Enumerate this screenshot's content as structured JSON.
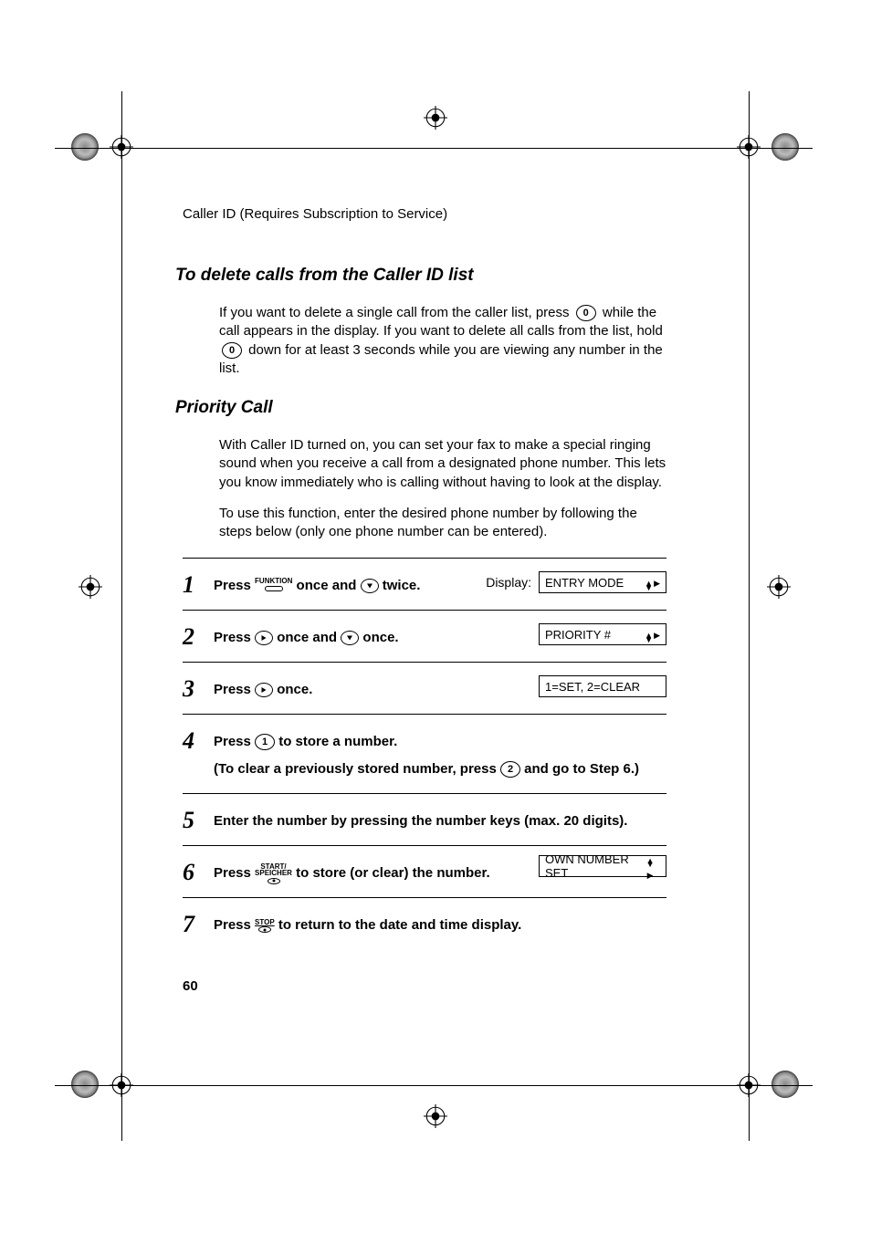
{
  "header": "Caller ID (Requires Subscription to Service)",
  "section1": {
    "title": "To delete calls from the Caller ID list",
    "p1a": "If you want to delete a single call from the caller list, press ",
    "p1b": " while the call appears in the display. If you want to delete all calls from the list, hold ",
    "p1c": " down for at least 3 seconds while you are viewing any number in the list.",
    "key0a": "0",
    "key0b": "0"
  },
  "section2": {
    "title": "Priority Call",
    "p1": "With Caller ID turned on, you can set your fax to make a special ringing sound when you receive a call from a designated phone number. This lets you know immediately who is calling without having to look at the display.",
    "p2": "To use this function, enter the desired phone number by following the steps below (only one phone number can be entered)."
  },
  "steps": {
    "s1": {
      "num": "1",
      "t1": "Press ",
      "funk": "FUNKTION",
      "t2": " once and ",
      "t3": " twice.",
      "displayLabel": "Display:",
      "lcd": "ENTRY MODE"
    },
    "s2": {
      "num": "2",
      "t1": "Press ",
      "t2": " once and ",
      "t3": " once.",
      "lcd": "PRIORITY #"
    },
    "s3": {
      "num": "3",
      "t1": "Press ",
      "t2": " once.",
      "lcd": "1=SET, 2=CLEAR"
    },
    "s4": {
      "num": "4",
      "t1": "Press ",
      "key1": "1",
      "t2": " to store a number.",
      "sub1": "(To clear a previously stored number, press ",
      "key2": "2",
      "sub2": " and go to Step 6.)"
    },
    "s5": {
      "num": "5",
      "t1": "Enter the number by pressing the number keys (max. 20 digits)."
    },
    "s6": {
      "num": "6",
      "t1": "Press ",
      "start1": "START/",
      "start2": "SPEICHER",
      "t2": " to store (or clear) the number.",
      "lcd": "OWN NUMBER SET"
    },
    "s7": {
      "num": "7",
      "t1": "Press ",
      "stop": "STOP",
      "t2": " to return to the date and time display."
    }
  },
  "pageNum": "60"
}
